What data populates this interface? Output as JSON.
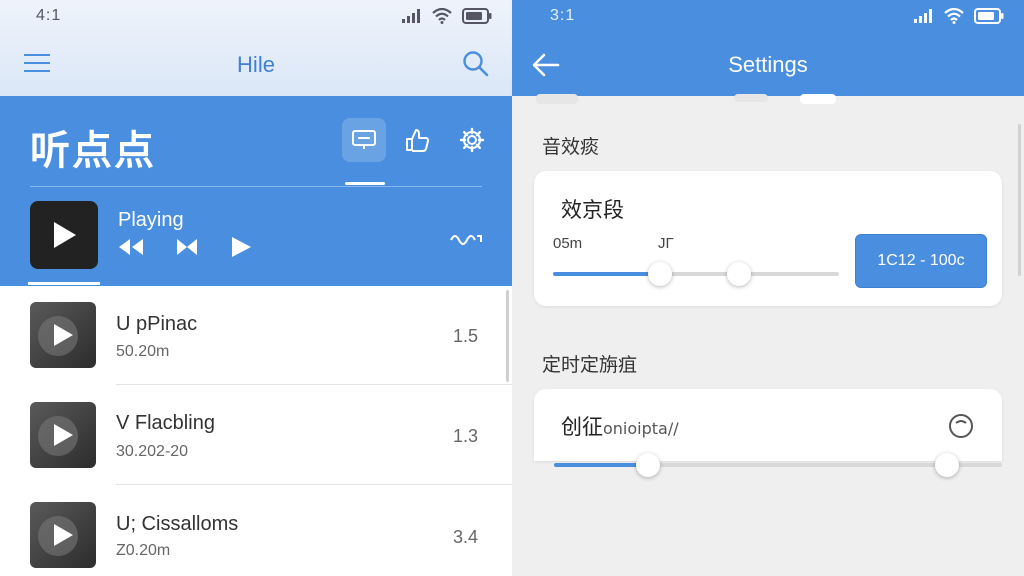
{
  "left_screen": {
    "status": {
      "time": "4:1"
    },
    "appbar": {
      "title": "Hile"
    },
    "header": {
      "brand": "听点点",
      "now_playing_label": "Playing"
    },
    "tracks": [
      {
        "title": "U  pPinac",
        "subtitle": "50.20m",
        "value": "1.5"
      },
      {
        "title": "V Flacbling",
        "subtitle": "30.202-20",
        "value": "1.3"
      },
      {
        "title": "U; Cissalloms",
        "subtitle": "Z0.20m",
        "value": "3.4"
      }
    ]
  },
  "right_screen": {
    "status": {
      "time": "3:1"
    },
    "appbar": {
      "title": "Settings"
    },
    "section1": {
      "label": "音效痰",
      "card_title": "效京段",
      "left_label": "05m",
      "mid_label": "JГ",
      "button_label": "1C12 - 100c",
      "slider_value": 0.38
    },
    "section2": {
      "label": "定时定旃疽",
      "card_title": "创征",
      "card_suffix": "onioipta//",
      "slider_value": 0.2
    }
  },
  "colors": {
    "accent": "#4a8fdf",
    "header_blue": "#4a8fdf",
    "text_dark": "#333333"
  },
  "icons": [
    "menu-icon",
    "search-icon",
    "message-icon",
    "thumbs-up-icon",
    "gear-icon",
    "play-icon",
    "rewind-icon",
    "skip-icon",
    "wave-icon",
    "back-arrow-icon",
    "timer-icon",
    "wifi-icon",
    "signal-icon",
    "battery-icon"
  ]
}
